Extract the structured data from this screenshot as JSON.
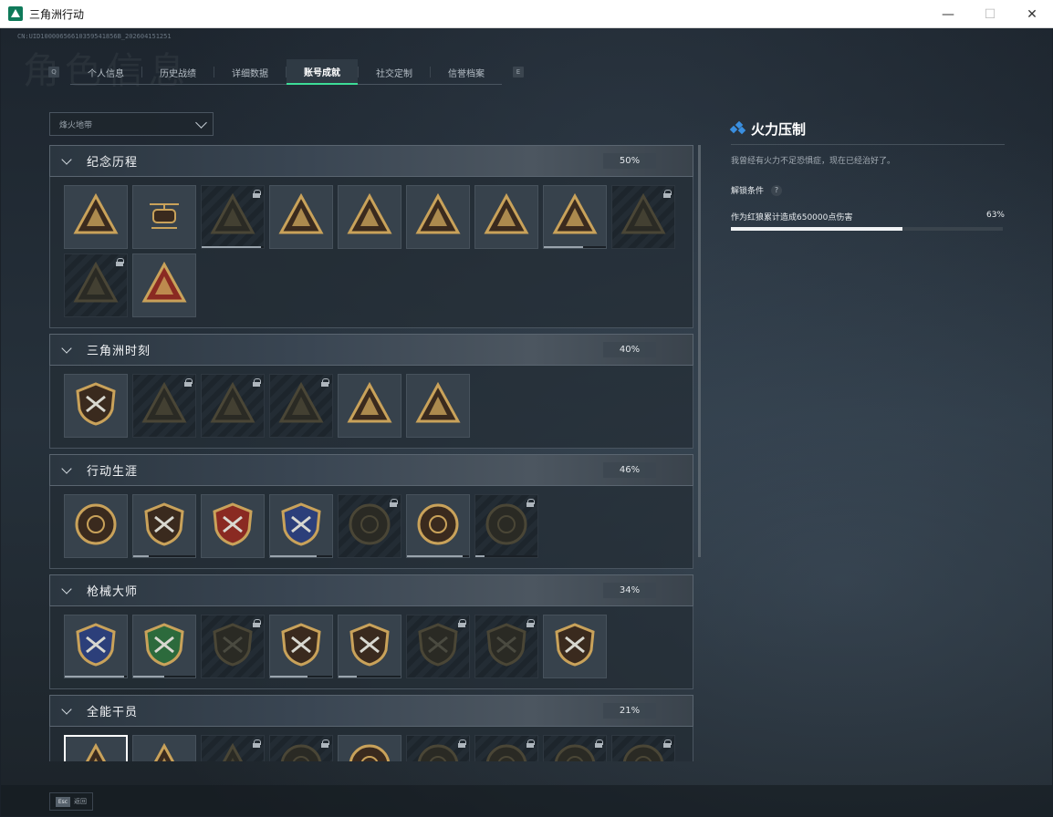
{
  "window": {
    "title": "三角洲行动",
    "min": "—",
    "max": "☐",
    "close": "✕"
  },
  "uid": "CN:UID10000656610359541856B_202604151251",
  "watermark": "角色信息",
  "tabs": {
    "left_key": "Q",
    "right_key": "E",
    "items": [
      {
        "label": "个人信息"
      },
      {
        "label": "历史战绩"
      },
      {
        "label": "详细数据"
      },
      {
        "label": "账号成就",
        "active": true
      },
      {
        "label": "社交定制"
      },
      {
        "label": "信誉档案"
      }
    ]
  },
  "filter": {
    "value": "烽火地带"
  },
  "categories": [
    {
      "title": "纪念历程",
      "percent": "50%",
      "badges": [
        {
          "icon": "triangle-emblem-icon",
          "locked": false
        },
        {
          "icon": "helicopter-icon",
          "locked": false
        },
        {
          "icon": "dark-emblem-icon",
          "locked": true,
          "progress": 0.95
        },
        {
          "icon": "s4-triangle-icon",
          "locked": false
        },
        {
          "icon": "s5-triangle-icon",
          "locked": false
        },
        {
          "icon": "s6-triangle-icon",
          "locked": false
        },
        {
          "icon": "s7-triangle-icon",
          "locked": false
        },
        {
          "icon": "s8-triangle-icon",
          "locked": false,
          "progress": 0.63
        },
        {
          "icon": "skull-triangle-icon",
          "locked": true
        },
        {
          "icon": "skull-dark-icon",
          "locked": true
        },
        {
          "icon": "number-one-icon",
          "locked": false
        }
      ]
    },
    {
      "title": "三角洲时刻",
      "percent": "40%",
      "badges": [
        {
          "icon": "shield-triangle-icon",
          "locked": false
        },
        {
          "icon": "radio-triangle-icon",
          "locked": true
        },
        {
          "icon": "soldier-triangle-icon",
          "locked": true
        },
        {
          "icon": "beast-triangle-icon",
          "locked": true
        },
        {
          "icon": "squad-triangle-icon",
          "locked": false
        },
        {
          "icon": "rocket-triangle-icon",
          "locked": false
        }
      ]
    },
    {
      "title": "行动生涯",
      "percent": "46%",
      "badges": [
        {
          "icon": "star-medal-icon",
          "locked": false
        },
        {
          "icon": "rank-shield-icon",
          "locked": false,
          "progress": 0.25
        },
        {
          "icon": "red-crest-icon",
          "locked": false
        },
        {
          "icon": "blue-crest-icon",
          "locked": false,
          "progress": 0.75
        },
        {
          "icon": "round-emblem-icon",
          "locked": true
        },
        {
          "icon": "crosshair-skull-icon",
          "locked": false,
          "progress": 0.9
        },
        {
          "icon": "eye-emblem-icon",
          "locked": true,
          "progress": 0.15
        }
      ]
    },
    {
      "title": "枪械大师",
      "percent": "34%",
      "badges": [
        {
          "icon": "blue-gun-shield-icon",
          "locked": false,
          "progress": 0.95
        },
        {
          "icon": "green-gun-shield-icon",
          "locked": false,
          "progress": 0.5
        },
        {
          "icon": "gun-shield-dark-icon",
          "locked": true
        },
        {
          "icon": "rifle-shield-icon",
          "locked": false,
          "progress": 0.6
        },
        {
          "icon": "sniper-shield-icon",
          "locked": false,
          "progress": 0.3
        },
        {
          "icon": "smg-shield-dark-icon",
          "locked": true
        },
        {
          "icon": "pistol-shield-dark-icon",
          "locked": true
        },
        {
          "icon": "gold-gun-shield-icon",
          "locked": false
        }
      ]
    },
    {
      "title": "全能干员",
      "percent": "21%",
      "badges": [
        {
          "icon": "operator-red-icon",
          "locked": false,
          "selected": true
        },
        {
          "icon": "operator-lion-icon",
          "locked": false
        },
        {
          "icon": "operator-red-dark-icon",
          "locked": true
        },
        {
          "icon": "operator-wolf-dark-icon",
          "locked": true
        },
        {
          "icon": "operator-wolf-icon",
          "locked": false
        },
        {
          "icon": "operator-spear-dark-icon",
          "locked": true
        },
        {
          "icon": "operator-helmet-dark-icon",
          "locked": true
        },
        {
          "icon": "operator-mask-dark-icon",
          "locked": true
        },
        {
          "icon": "operator-ring-dark-icon",
          "locked": true
        }
      ]
    }
  ],
  "detail": {
    "title": "火力压制",
    "description": "我曾经有火力不足恐惧症，现在已经治好了。",
    "condition_label": "解锁条件",
    "condition_text": "作为红狼累计造成650000点伤害",
    "progress_text": "63%",
    "progress": 0.63
  },
  "bottom": {
    "esc_key": "Esc",
    "esc_label": "返回"
  },
  "colors": {
    "accent": "#3ddc97",
    "gold": "#c9a25a",
    "detail_icon": "#3a8fe0"
  }
}
